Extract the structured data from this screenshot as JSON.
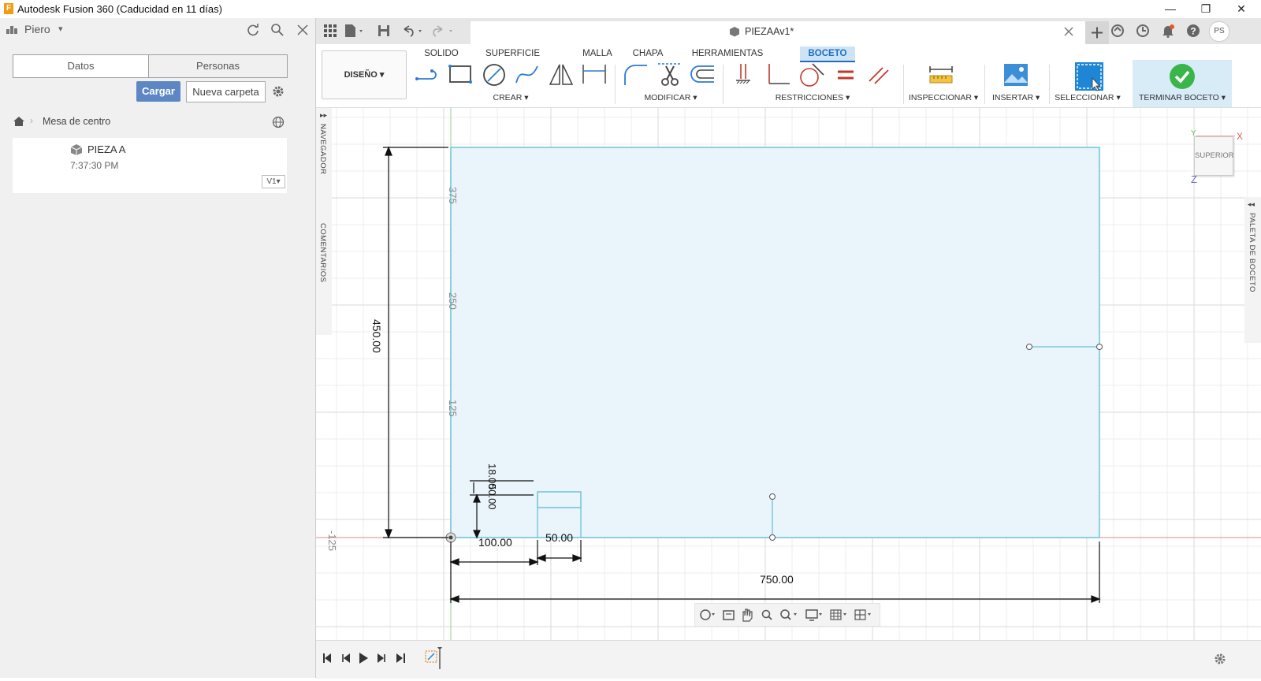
{
  "window": {
    "title": "Autodesk Fusion 360 (Caducidad en 11 días)",
    "app_icon": "F",
    "controls": {
      "minimize": "—",
      "restore": "❐",
      "close": "✕"
    }
  },
  "left_panel": {
    "user": "Piero",
    "tabs": {
      "data": "Datos",
      "people": "Personas"
    },
    "upload_label": "Cargar",
    "new_folder_label": "Nueva carpeta",
    "breadcrumb": "Mesa de centro",
    "file": {
      "name": "PIEZA A",
      "time": "7:37:30 PM",
      "version": "V1"
    }
  },
  "doc_tab": {
    "title": "PIEZAAv1*"
  },
  "user_badge": "PS",
  "ribbon": {
    "tabs": [
      "SOLIDO",
      "SUPERFICIE",
      "MALLA",
      "CHAPA",
      "HERRAMIENTAS",
      "BOCETO"
    ],
    "active_tab": "BOCETO",
    "workspace_label": "DISEÑO",
    "groups": {
      "create": "CREAR",
      "modify": "MODIFICAR",
      "constraints": "RESTRICCIONES",
      "inspect": "INSPECCIONAR",
      "insert": "INSERTAR",
      "select": "SELECCIONAR",
      "finish": "TERMINAR BOCETO"
    }
  },
  "side_panels": {
    "navigator": "NAVEGADOR",
    "comments": "COMENTARIOS",
    "sketch_palette": "PALETA DE BOCETO"
  },
  "viewcube": {
    "face": "SUPERIOR",
    "x": "X",
    "y": "Y",
    "z": "Z"
  },
  "sketch": {
    "ruler_labels": [
      "375",
      "250",
      "125",
      "-125"
    ],
    "dimensions": {
      "height": "450.00",
      "width": "750.00",
      "offset_x": "100.00",
      "slot_width": "50.00",
      "slot_height": "18.00",
      "slot_offset_y": "50.00"
    },
    "colors": {
      "fill": "#eaf4fb",
      "line": "#6cc4d8",
      "axis_red": "#e8a0a0",
      "axis_green": "#a7d7a7"
    }
  }
}
